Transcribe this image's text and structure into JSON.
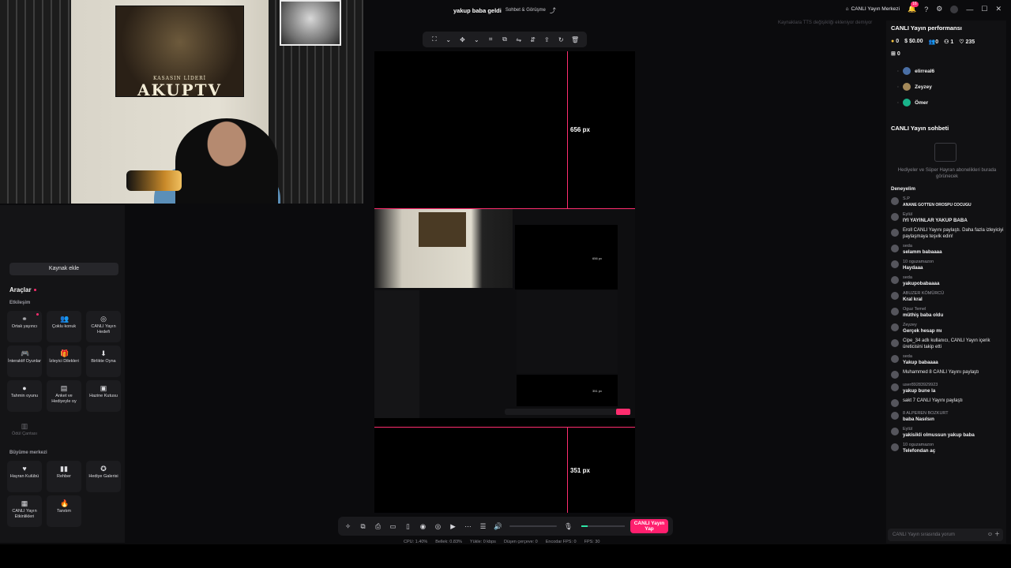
{
  "webcam": {
    "poster_subtitle": "KASASIN LİDERİ",
    "poster_title": "AKUPTV"
  },
  "header": {
    "stream_title": "yakup baba geldi",
    "category": "Sohbet & Görüşme",
    "live_center": "CANLI Yayın Merkezi",
    "notification_count": "16",
    "hint": "Kaynaklara TTS değişikliği ekleniyor demiyor"
  },
  "preview": {
    "top_height_label": "656 px",
    "bottom_height_label": "351 px"
  },
  "left_panel": {
    "add_source": "Kaynak ekle",
    "tools_title": "Araçlar",
    "section_interaction": "Etkileşim",
    "section_growth": "Büyüme merkezi",
    "tools": [
      {
        "label": "Ortak yayıncı",
        "icon": "co-host-icon"
      },
      {
        "label": "Çoklu konuk",
        "icon": "multi-guest-icon"
      },
      {
        "label": "CANLI Yayın Hedefi",
        "icon": "live-goal-icon"
      },
      {
        "label": "İnteraktif Oyunlar",
        "icon": "gamepad-icon"
      },
      {
        "label": "İzleyici Dilekleri",
        "icon": "viewer-wishes-icon"
      },
      {
        "label": "Birlikte Oyna",
        "icon": "play-together-icon"
      },
      {
        "label": "Tahmin oyunu",
        "icon": "prediction-icon"
      },
      {
        "label": "Anket ve Hediyeyle oy",
        "icon": "poll-icon"
      },
      {
        "label": "Hazine Kutusu",
        "icon": "treasure-box-icon"
      },
      {
        "label": "Ödül Çantası",
        "icon": "reward-bag-icon"
      }
    ],
    "growth_tools": [
      {
        "label": "Hayran Kulübü",
        "icon": "fan-club-icon"
      },
      {
        "label": "Rehber",
        "icon": "guide-icon"
      },
      {
        "label": "Hediye Galerisi",
        "icon": "gift-gallery-icon"
      },
      {
        "label": "CANLI Yayın Etkinlikleri",
        "icon": "live-events-icon"
      },
      {
        "label": "Tanıtım",
        "icon": "promote-icon"
      }
    ]
  },
  "bottom_bar": {
    "go_live": "CANLI Yayın Yap",
    "stats": [
      "CPU: 1.40%",
      "Bellek: 0.83%",
      "Yükle: 0 kbps",
      "Düşen çerçeve: 0",
      "Encodar FPS: 0",
      "FPS: 30"
    ]
  },
  "right_panel": {
    "perf_title": "CANLI Yayın performansı",
    "perf": {
      "coins": "0",
      "earnings": "$0.00",
      "viewers": "0",
      "new_followers": "1",
      "likes": "235",
      "gifts": "0"
    },
    "viewers": [
      "elirreal6",
      "Zeyzey",
      "Ömer"
    ],
    "chat_title": "CANLI Yayın sohbeti",
    "gift_placeholder": "Hediyeler ve Süper Hayran abonelikleri burada görünecek",
    "chat_input_placeholder": "CANLI Yayın sırasında yorum",
    "messages": [
      {
        "name": "",
        "text": "Deneyelim"
      },
      {
        "name": "S.P",
        "text": "ANANE GOTTEN OROSPU COCUGU"
      },
      {
        "name": "Eylül",
        "text": "IYI YAYINLAR YAKUP BABA"
      },
      {
        "name": "",
        "system": "Eroll CANLI Yayını paylaştı. Daha fazla izleyiciyi paylaşmaya teşvik edin!"
      },
      {
        "name": "seda",
        "text": "selamm babaaaa"
      },
      {
        "name": "10 oguzamazon",
        "text": "Haydaaa"
      },
      {
        "name": "seda",
        "text": "yakupobabaaaa"
      },
      {
        "name": "ABUZER KÖMÜRCÜ",
        "text": "Kral kral"
      },
      {
        "name": "Oguz Temel",
        "text": "müthiş baba oldu"
      },
      {
        "name": "Zeyzey",
        "text": "Gerçek hesap mı"
      },
      {
        "name": "",
        "system": "Cipe_34 adlı kullanıcı, CANLI Yayın içerik üreticisini takip etti"
      },
      {
        "name": "seda",
        "text": "Yakup babaaaa"
      },
      {
        "name": "",
        "system": "Muhammed 8 CANLI Yayını paylaştı"
      },
      {
        "name": "user89283929923",
        "text": "yakup bune la"
      },
      {
        "name": "",
        "system": "sakt 7 CANLI Yayını paylaştı"
      },
      {
        "name": "8 ALPEREN BOZKURT",
        "text": "baba Nasılsın"
      },
      {
        "name": "Eylül",
        "text": "yakisikli olmussun yakup baba"
      },
      {
        "name": "10 oguzamazon",
        "text": "Telefondan aç"
      }
    ]
  }
}
